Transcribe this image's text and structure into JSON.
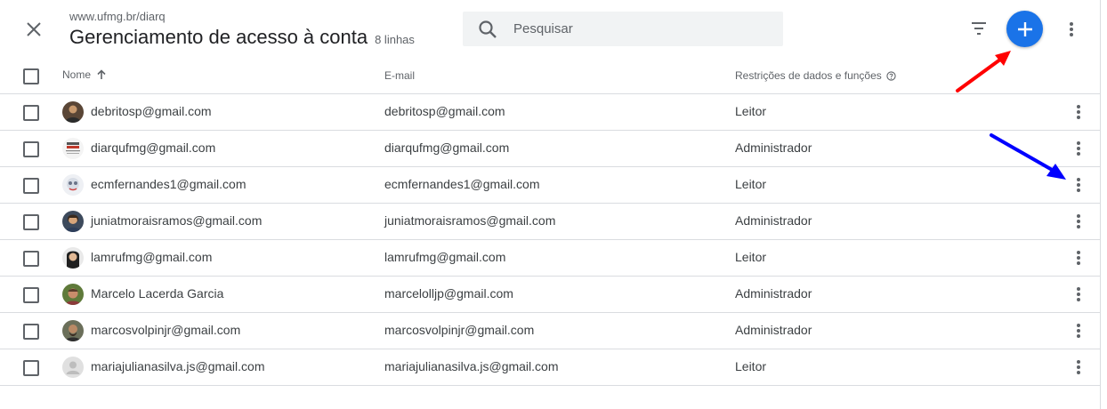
{
  "header": {
    "site": "www.ufmg.br/diarq",
    "title": "Gerenciamento de acesso à conta",
    "row_count": "8 linhas",
    "search_placeholder": "Pesquisar"
  },
  "columns": {
    "name": "Nome",
    "email": "E-mail",
    "role": "Restrições de dados e funções"
  },
  "rows": [
    {
      "name": "debritosp@gmail.com",
      "email": "debritosp@gmail.com",
      "role": "Leitor"
    },
    {
      "name": "diarqufmg@gmail.com",
      "email": "diarqufmg@gmail.com",
      "role": "Administrador"
    },
    {
      "name": "ecmfernandes1@gmail.com",
      "email": "ecmfernandes1@gmail.com",
      "role": "Leitor"
    },
    {
      "name": "juniatmoraisramos@gmail.com",
      "email": "juniatmoraisramos@gmail.com",
      "role": "Administrador"
    },
    {
      "name": "lamrufmg@gmail.com",
      "email": "lamrufmg@gmail.com",
      "role": "Leitor"
    },
    {
      "name": "Marcelo Lacerda Garcia",
      "email": "marcelolljp@gmail.com",
      "role": "Administrador"
    },
    {
      "name": "marcosvolpinjr@gmail.com",
      "email": "marcosvolpinjr@gmail.com",
      "role": "Administrador"
    },
    {
      "name": "mariajulianasilva.js@gmail.com",
      "email": "mariajulianasilva.js@gmail.com",
      "role": "Leitor"
    }
  ],
  "colors": {
    "accent": "#1a73e8",
    "annotation_red": "#ff0000",
    "annotation_blue": "#0000ff"
  }
}
